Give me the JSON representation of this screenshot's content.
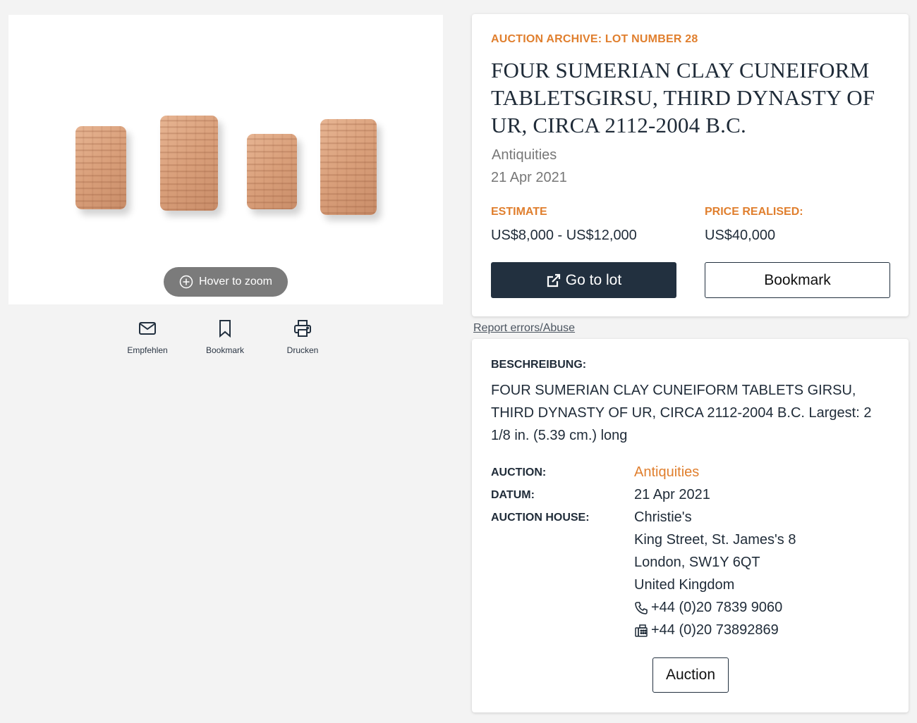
{
  "image_panel": {
    "zoom_hint": "Hover to zoom",
    "actions": [
      {
        "label": "Empfehlen",
        "icon": "envelope-icon"
      },
      {
        "label": "Bookmark",
        "icon": "bookmark-icon"
      },
      {
        "label": "Drucken",
        "icon": "printer-icon"
      }
    ]
  },
  "lot": {
    "eyebrow": "AUCTION ARCHIVE: LOT NUMBER 28",
    "title": "FOUR SUMERIAN CLAY CUNEIFORM TABLETSGIRSU, THIRD DYNASTY OF UR, CIRCA 2112-2004 B.C.",
    "category": "Antiquities",
    "date": "21 Apr 2021",
    "estimate_label": "ESTIMATE",
    "estimate_value": "US$8,000 - US$12,000",
    "price_label": "PRICE REALISED:",
    "price_value": "US$40,000",
    "go_to_lot_label": "Go to lot",
    "bookmark_label": "Bookmark"
  },
  "report_link": "Report errors/Abuse",
  "description": {
    "label": "BESCHREIBUNG:",
    "text": "FOUR SUMERIAN CLAY CUNEIFORM TABLETS GIRSU, THIRD DYNASTY OF UR, CIRCA 2112-2004 B.C. Largest: 2 1/8 in. (5.39 cm.) long",
    "auction_label": "AUCTION:",
    "auction_value": "Antiquities",
    "datum_label": "DATUM:",
    "datum_value": "21 Apr 2021",
    "house_label": "AUCTION HOUSE:",
    "house_name": "Christie's",
    "address_line1": "King Street, St. James's 8",
    "address_line2": "London, SW1Y 6QT",
    "address_line3": "United Kingdom",
    "phone": "+44 (0)20 7839 9060",
    "fax": "+44 (0)20 73892869",
    "auction_button": "Auction"
  },
  "colors": {
    "accent": "#e07f2e",
    "navy": "#22303f",
    "background": "#f3f3f3"
  }
}
